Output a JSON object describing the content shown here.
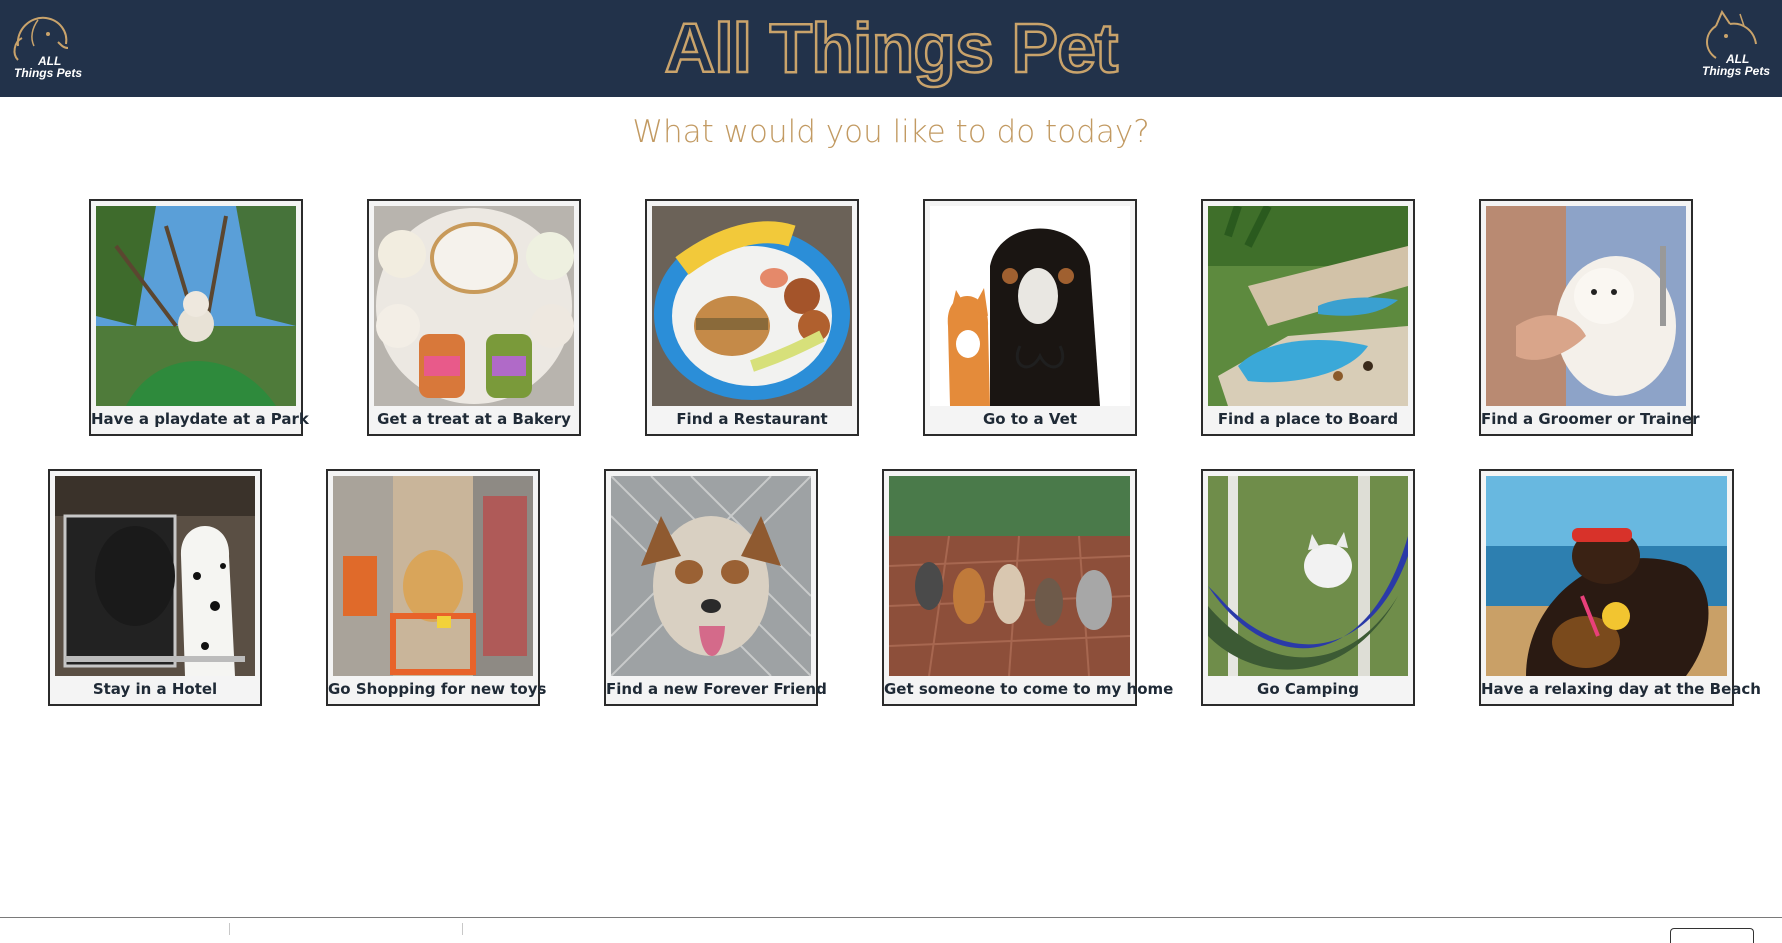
{
  "header": {
    "title": "All Things Pet",
    "logo_all": "ALL",
    "logo_pets": "Things Pets",
    "bg_color": "#22324a",
    "accent_color": "#c9a36b"
  },
  "prompt": "What would you like to do today?",
  "activities": [
    {
      "label": "Have a playdate at a Park",
      "icon": "park-photo"
    },
    {
      "label": "Get a treat at a Bakery",
      "icon": "bakery-photo"
    },
    {
      "label": "Find a Restaurant",
      "icon": "restaurant-photo"
    },
    {
      "label": "Go to a Vet",
      "icon": "vet-photo"
    },
    {
      "label": "Find a place to Board",
      "icon": "board-photo"
    },
    {
      "label": "Find a Groomer or Trainer",
      "icon": "groomer-photo"
    },
    {
      "label": "Stay in a Hotel",
      "icon": "hotel-photo"
    },
    {
      "label": "Go Shopping for new toys",
      "icon": "shopping-photo"
    },
    {
      "label": "Find a new Forever Friend",
      "icon": "adoption-photo"
    },
    {
      "label": "Get someone to come to my home",
      "icon": "home-visit-photo"
    },
    {
      "label": "Go Camping",
      "icon": "camping-photo"
    },
    {
      "label": "Have a relaxing day at the Beach",
      "icon": "beach-photo"
    }
  ]
}
